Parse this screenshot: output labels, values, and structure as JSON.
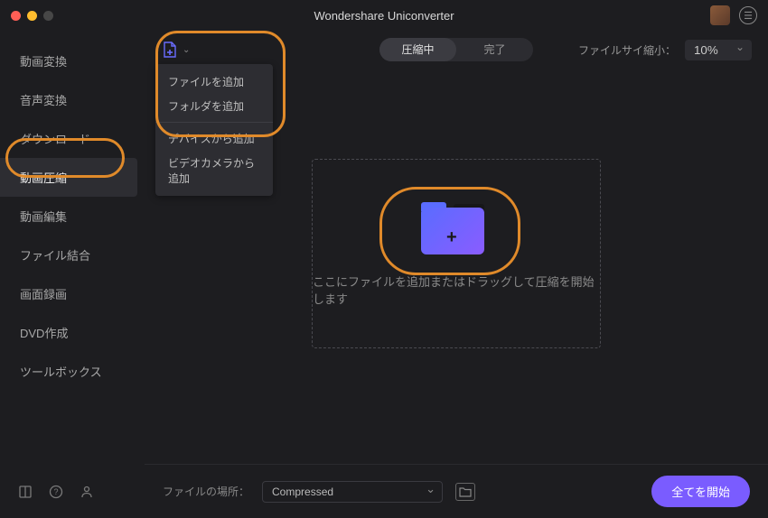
{
  "title": "Wondershare Uniconverter",
  "sidebar": {
    "items": [
      {
        "label": "動画変換"
      },
      {
        "label": "音声変換"
      },
      {
        "label": "ダウンロード"
      },
      {
        "label": "動画圧縮"
      },
      {
        "label": "動画編集"
      },
      {
        "label": "ファイル結合"
      },
      {
        "label": "画面録画"
      },
      {
        "label": "DVD作成"
      },
      {
        "label": "ツールボックス"
      }
    ],
    "active_index": 3
  },
  "add_menu": {
    "items_top": [
      "ファイルを追加",
      "フォルダを追加"
    ],
    "items_bottom": [
      "デバイスから追加",
      "ビデオカメラから追加"
    ]
  },
  "tabs": {
    "active": "圧縮中",
    "other": "完了"
  },
  "size_reduce": {
    "label": "ファイルサイ縮小：",
    "value": "10%"
  },
  "dropzone": {
    "text": "ここにファイルを追加またはドラッグして圧縮を開始します"
  },
  "footer": {
    "location_label": "ファイルの場所：",
    "location_value": "Compressed",
    "start_label": "全てを開始"
  }
}
